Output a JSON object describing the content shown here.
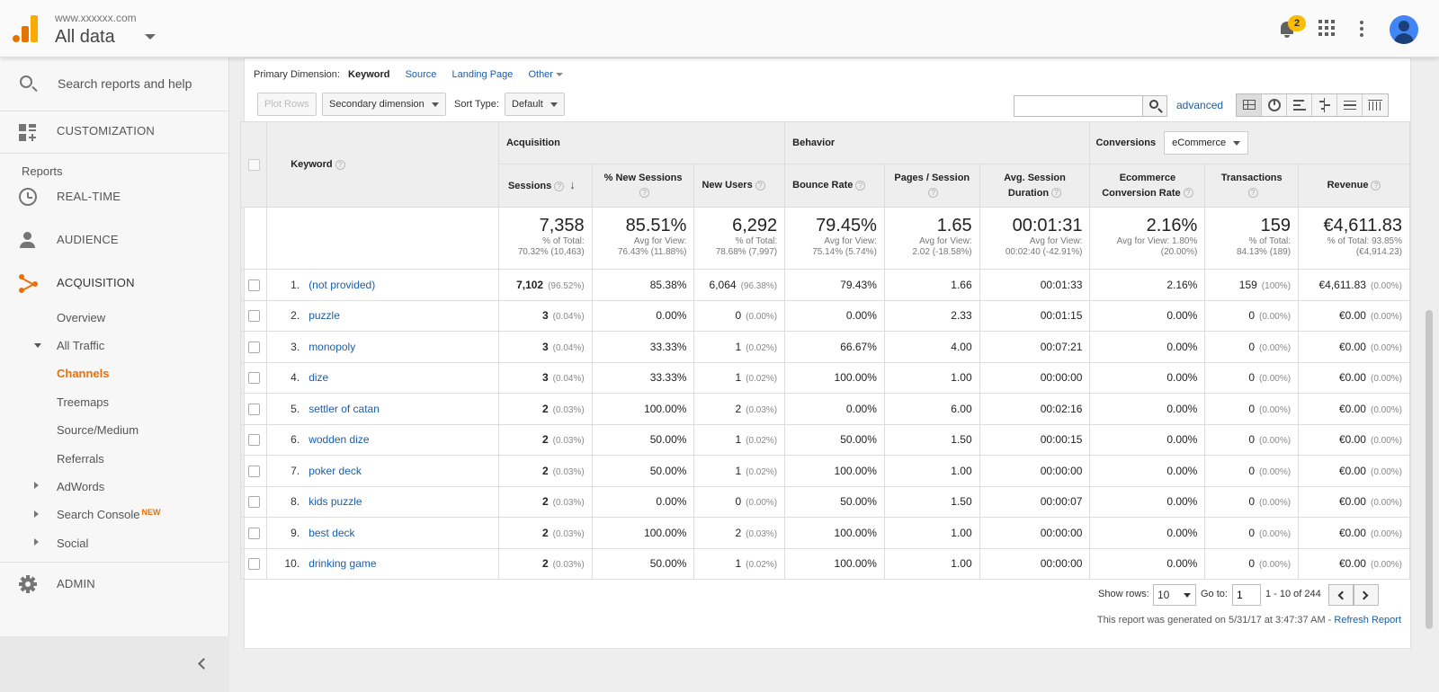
{
  "header": {
    "account_url": "www.xxxxxx.com",
    "view_name": "All data",
    "notification_count": "2"
  },
  "sidebar": {
    "search_placeholder": "Search reports and help",
    "customization": "CUSTOMIZATION",
    "reports_label": "Reports",
    "realtime": "REAL-TIME",
    "audience": "AUDIENCE",
    "acquisition": "ACQUISITION",
    "overview": "Overview",
    "all_traffic": "All Traffic",
    "channels": "Channels",
    "treemaps": "Treemaps",
    "source_medium": "Source/Medium",
    "referrals": "Referrals",
    "adwords": "AdWords",
    "search_console": "Search Console",
    "new_tag": "NEW",
    "social": "Social",
    "admin": "ADMIN"
  },
  "toolbar": {
    "primary_dimension_label": "Primary Dimension:",
    "dim_keyword": "Keyword",
    "dim_source": "Source",
    "dim_landing_page": "Landing Page",
    "dim_other": "Other",
    "plot_rows": "Plot Rows",
    "secondary_dimension": "Secondary dimension",
    "sort_type_label": "Sort Type:",
    "sort_type_value": "Default",
    "advanced": "advanced"
  },
  "table": {
    "keyword_header": "Keyword",
    "groups": {
      "acquisition": "Acquisition",
      "behavior": "Behavior",
      "conversions": "Conversions",
      "conversions_select": "eCommerce"
    },
    "columns": {
      "sessions": "Sessions",
      "new_sessions": "% New Sessions",
      "new_users": "New Users",
      "bounce_rate": "Bounce Rate",
      "pages_session_1": "Pages / Session",
      "avg_duration_1": "Avg. Session",
      "avg_duration_2": "Duration",
      "ecom_rate_1": "Ecommerce",
      "ecom_rate_2": "Conversion Rate",
      "transactions": "Transactions",
      "revenue": "Revenue"
    },
    "totals": {
      "sessions": {
        "value": "7,358",
        "l1": "% of Total:",
        "l2": "70.32% (10,463)"
      },
      "new_sessions": {
        "value": "85.51%",
        "l1": "Avg for View:",
        "l2": "76.43% (11.88%)"
      },
      "new_users": {
        "value": "6,292",
        "l1": "% of Total:",
        "l2": "78.68% (7,997)"
      },
      "bounce_rate": {
        "value": "79.45%",
        "l1": "Avg for View:",
        "l2": "75.14% (5.74%)"
      },
      "pages_session": {
        "value": "1.65",
        "l1": "Avg for View:",
        "l2": "2.02 (-18.58%)"
      },
      "avg_duration": {
        "value": "00:01:31",
        "l1": "Avg for View:",
        "l2": "00:02:40 (-42.91%)"
      },
      "ecom_rate": {
        "value": "2.16%",
        "l1": "Avg for View: 1.80%",
        "l2": "(20.00%)"
      },
      "transactions": {
        "value": "159",
        "l1": "% of Total:",
        "l2": "84.13% (189)"
      },
      "revenue": {
        "value": "€4,611.83",
        "l1": "% of Total: 93.85%",
        "l2": "(€4,914.23)"
      }
    },
    "rows": [
      {
        "idx": "1.",
        "keyword": "(not provided)",
        "sessions": "7,102",
        "sessions_pct": "(96.52%)",
        "new_sessions": "85.38%",
        "new_users": "6,064",
        "new_users_pct": "(96.38%)",
        "bounce": "79.43%",
        "pages": "1.66",
        "duration": "00:01:33",
        "ecom": "2.16%",
        "trans": "159",
        "trans_pct": "(100%)",
        "revenue": "€4,611.83",
        "revenue_pct": "(0.00%)"
      },
      {
        "idx": "2.",
        "keyword": "puzzle",
        "sessions": "3",
        "sessions_pct": "(0.04%)",
        "new_sessions": "0.00%",
        "new_users": "0",
        "new_users_pct": "(0.00%)",
        "bounce": "0.00%",
        "pages": "2.33",
        "duration": "00:01:15",
        "ecom": "0.00%",
        "trans": "0",
        "trans_pct": "(0.00%)",
        "revenue": "€0.00",
        "revenue_pct": "(0.00%)"
      },
      {
        "idx": "3.",
        "keyword": "monopoly",
        "sessions": "3",
        "sessions_pct": "(0.04%)",
        "new_sessions": "33.33%",
        "new_users": "1",
        "new_users_pct": "(0.02%)",
        "bounce": "66.67%",
        "pages": "4.00",
        "duration": "00:07:21",
        "ecom": "0.00%",
        "trans": "0",
        "trans_pct": "(0.00%)",
        "revenue": "€0.00",
        "revenue_pct": "(0.00%)"
      },
      {
        "idx": "4.",
        "keyword": "dize",
        "sessions": "3",
        "sessions_pct": "(0.04%)",
        "new_sessions": "33.33%",
        "new_users": "1",
        "new_users_pct": "(0.02%)",
        "bounce": "100.00%",
        "pages": "1.00",
        "duration": "00:00:00",
        "ecom": "0.00%",
        "trans": "0",
        "trans_pct": "(0.00%)",
        "revenue": "€0.00",
        "revenue_pct": "(0.00%)"
      },
      {
        "idx": "5.",
        "keyword": "settler of catan",
        "sessions": "2",
        "sessions_pct": "(0.03%)",
        "new_sessions": "100.00%",
        "new_users": "2",
        "new_users_pct": "(0.03%)",
        "bounce": "0.00%",
        "pages": "6.00",
        "duration": "00:02:16",
        "ecom": "0.00%",
        "trans": "0",
        "trans_pct": "(0.00%)",
        "revenue": "€0.00",
        "revenue_pct": "(0.00%)"
      },
      {
        "idx": "6.",
        "keyword": "wodden dize",
        "sessions": "2",
        "sessions_pct": "(0.03%)",
        "new_sessions": "50.00%",
        "new_users": "1",
        "new_users_pct": "(0.02%)",
        "bounce": "50.00%",
        "pages": "1.50",
        "duration": "00:00:15",
        "ecom": "0.00%",
        "trans": "0",
        "trans_pct": "(0.00%)",
        "revenue": "€0.00",
        "revenue_pct": "(0.00%)"
      },
      {
        "idx": "7.",
        "keyword": "poker deck",
        "sessions": "2",
        "sessions_pct": "(0.03%)",
        "new_sessions": "50.00%",
        "new_users": "1",
        "new_users_pct": "(0.02%)",
        "bounce": "100.00%",
        "pages": "1.00",
        "duration": "00:00:00",
        "ecom": "0.00%",
        "trans": "0",
        "trans_pct": "(0.00%)",
        "revenue": "€0.00",
        "revenue_pct": "(0.00%)"
      },
      {
        "idx": "8.",
        "keyword": "kids puzzle",
        "sessions": "2",
        "sessions_pct": "(0.03%)",
        "new_sessions": "0.00%",
        "new_users": "0",
        "new_users_pct": "(0.00%)",
        "bounce": "50.00%",
        "pages": "1.50",
        "duration": "00:00:07",
        "ecom": "0.00%",
        "trans": "0",
        "trans_pct": "(0.00%)",
        "revenue": "€0.00",
        "revenue_pct": "(0.00%)"
      },
      {
        "idx": "9.",
        "keyword": "best deck",
        "sessions": "2",
        "sessions_pct": "(0.03%)",
        "new_sessions": "100.00%",
        "new_users": "2",
        "new_users_pct": "(0.03%)",
        "bounce": "100.00%",
        "pages": "1.00",
        "duration": "00:00:00",
        "ecom": "0.00%",
        "trans": "0",
        "trans_pct": "(0.00%)",
        "revenue": "€0.00",
        "revenue_pct": "(0.00%)"
      },
      {
        "idx": "10.",
        "keyword": "drinking game",
        "sessions": "2",
        "sessions_pct": "(0.03%)",
        "new_sessions": "50.00%",
        "new_users": "1",
        "new_users_pct": "(0.02%)",
        "bounce": "100.00%",
        "pages": "1.00",
        "duration": "00:00:00",
        "ecom": "0.00%",
        "trans": "0",
        "trans_pct": "(0.00%)",
        "revenue": "€0.00",
        "revenue_pct": "(0.00%)"
      }
    ]
  },
  "pagination": {
    "show_rows_label": "Show rows:",
    "show_rows_value": "10",
    "goto_label": "Go to:",
    "goto_value": "1",
    "range": "1 - 10 of 244"
  },
  "footer": {
    "generated": "This report was generated on 5/31/17 at 3:47:37 AM - ",
    "refresh": "Refresh Report"
  },
  "colors": {
    "accent": "#e8710a",
    "link": "#1a5ea8",
    "badge": "#fbbc05"
  }
}
